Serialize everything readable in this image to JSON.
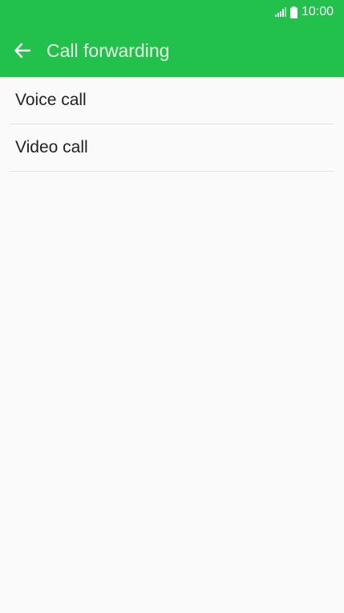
{
  "status_bar": {
    "time": "10:00",
    "icons": [
      "signal-icon",
      "battery-icon"
    ]
  },
  "app_bar": {
    "back_icon": "arrow-left-icon",
    "title": "Call forwarding"
  },
  "list": {
    "items": [
      {
        "label": "Voice call"
      },
      {
        "label": "Video call"
      }
    ]
  },
  "colors": {
    "app_bar_bg": "#22c14c",
    "title_text": "#e8fde6",
    "list_text": "#222222",
    "divider": "#e3e3e3",
    "background": "#fafafa"
  }
}
